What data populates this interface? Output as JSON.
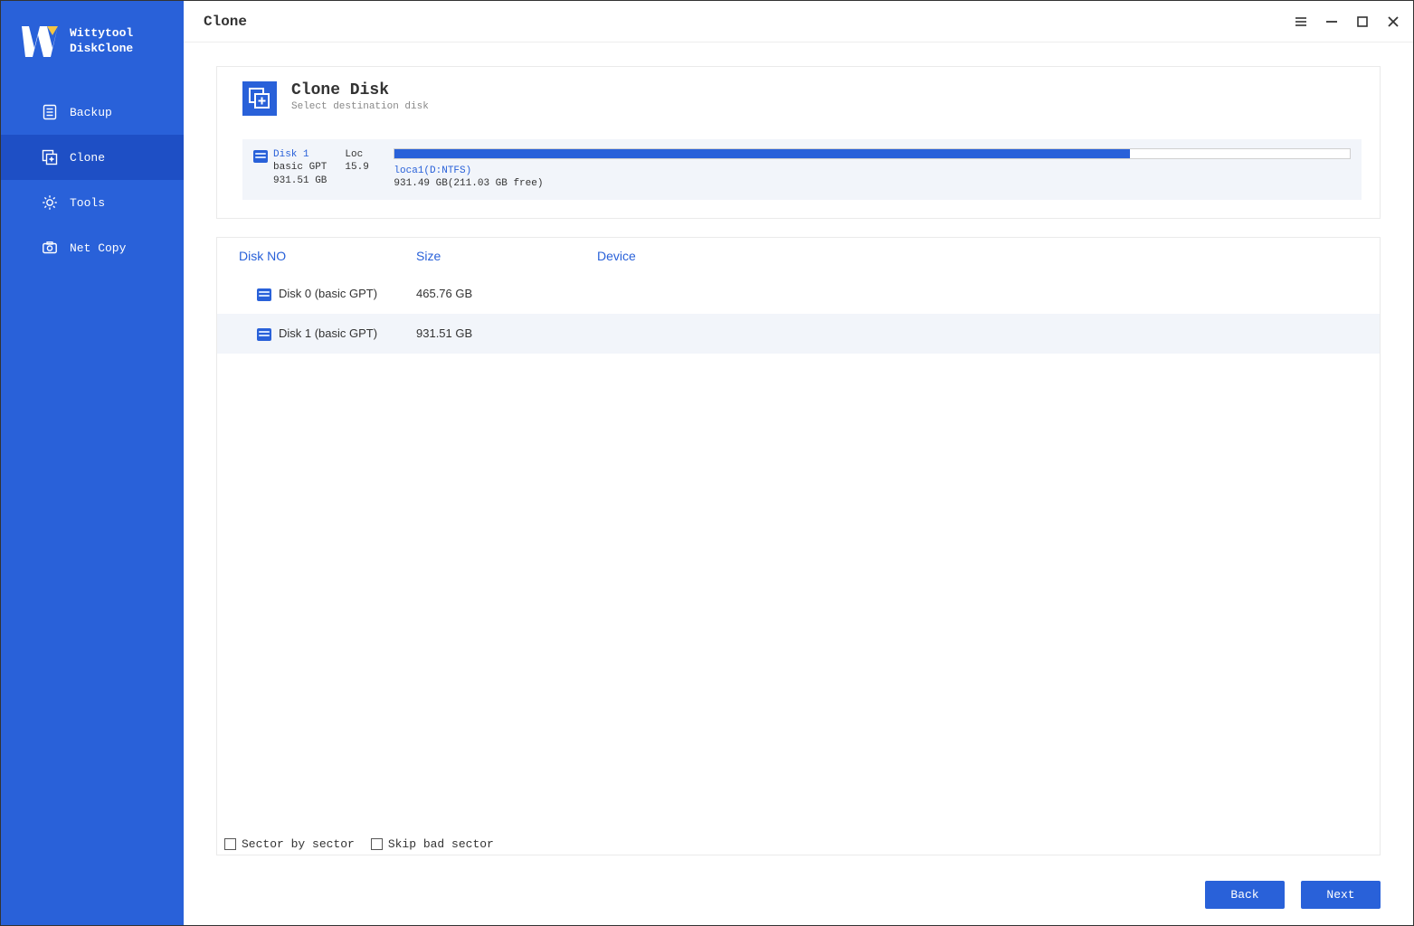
{
  "brand": {
    "line1": "Wittytool",
    "line2": "DiskClone"
  },
  "sidebar": {
    "items": [
      {
        "label": "Backup"
      },
      {
        "label": "Clone"
      },
      {
        "label": "Tools"
      },
      {
        "label": "Net Copy"
      }
    ]
  },
  "header": {
    "title": "Clone"
  },
  "clone_panel": {
    "title": "Clone Disk",
    "subtitle": "Select destination disk",
    "selected_disk": {
      "name": "Disk 1",
      "type": "basic GPT",
      "size": "931.51 GB",
      "loc_label": "Loc",
      "loc_value": "15.9",
      "partition_label": "loca1(D:NTFS)",
      "partition_sub": "931.49 GB(211.03 GB  free)",
      "used_percent": 77
    }
  },
  "columns": {
    "no": "Disk NO",
    "size": "Size",
    "device": "Device"
  },
  "disks": [
    {
      "name": "Disk 0 (basic GPT)",
      "size": "465.76 GB",
      "device": ""
    },
    {
      "name": "Disk 1 (basic GPT)",
      "size": "931.51 GB",
      "device": ""
    }
  ],
  "options": {
    "sector_by_sector": "Sector by sector",
    "skip_bad_sector": "Skip bad sector"
  },
  "buttons": {
    "back": "Back",
    "next": "Next"
  }
}
